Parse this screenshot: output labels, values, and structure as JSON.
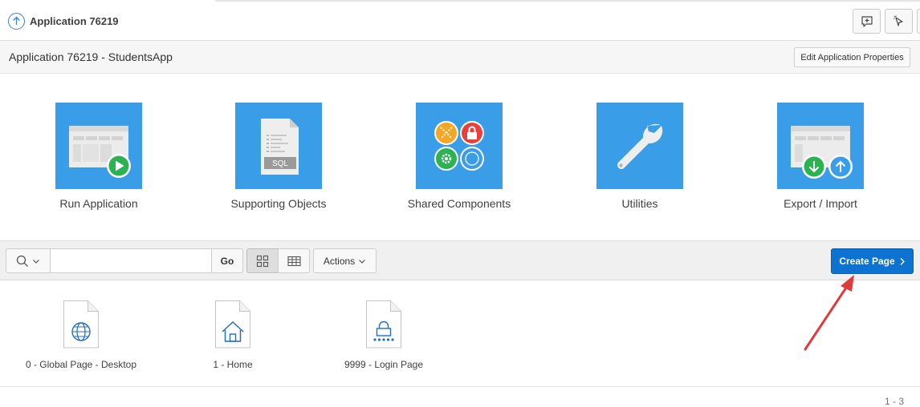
{
  "header": {
    "app_link_label": "Application 76219"
  },
  "titlebar": {
    "title": "Application 76219 - StudentsApp",
    "edit_button": "Edit Application Properties"
  },
  "tiles": [
    {
      "label": "Run Application",
      "icon": "run-application-icon"
    },
    {
      "label": "Supporting Objects",
      "icon": "sql-document-icon"
    },
    {
      "label": "Shared Components",
      "icon": "shared-components-icon"
    },
    {
      "label": "Utilities",
      "icon": "wrench-icon"
    },
    {
      "label": "Export / Import",
      "icon": "export-import-icon"
    }
  ],
  "toolbar": {
    "search_value": "",
    "go_label": "Go",
    "actions_label": "Actions",
    "create_label": "Create Page"
  },
  "pages": [
    {
      "label": "0 - Global Page - Desktop",
      "icon": "globe-icon"
    },
    {
      "label": "1 - Home",
      "icon": "home-icon"
    },
    {
      "label": "9999 - Login Page",
      "icon": "lock-icon"
    }
  ],
  "pagination": "1 - 3",
  "colors": {
    "tile_blue": "#3a9de8",
    "create_button": "#0d72d0",
    "annotation_arrow": "#e03a3a"
  }
}
